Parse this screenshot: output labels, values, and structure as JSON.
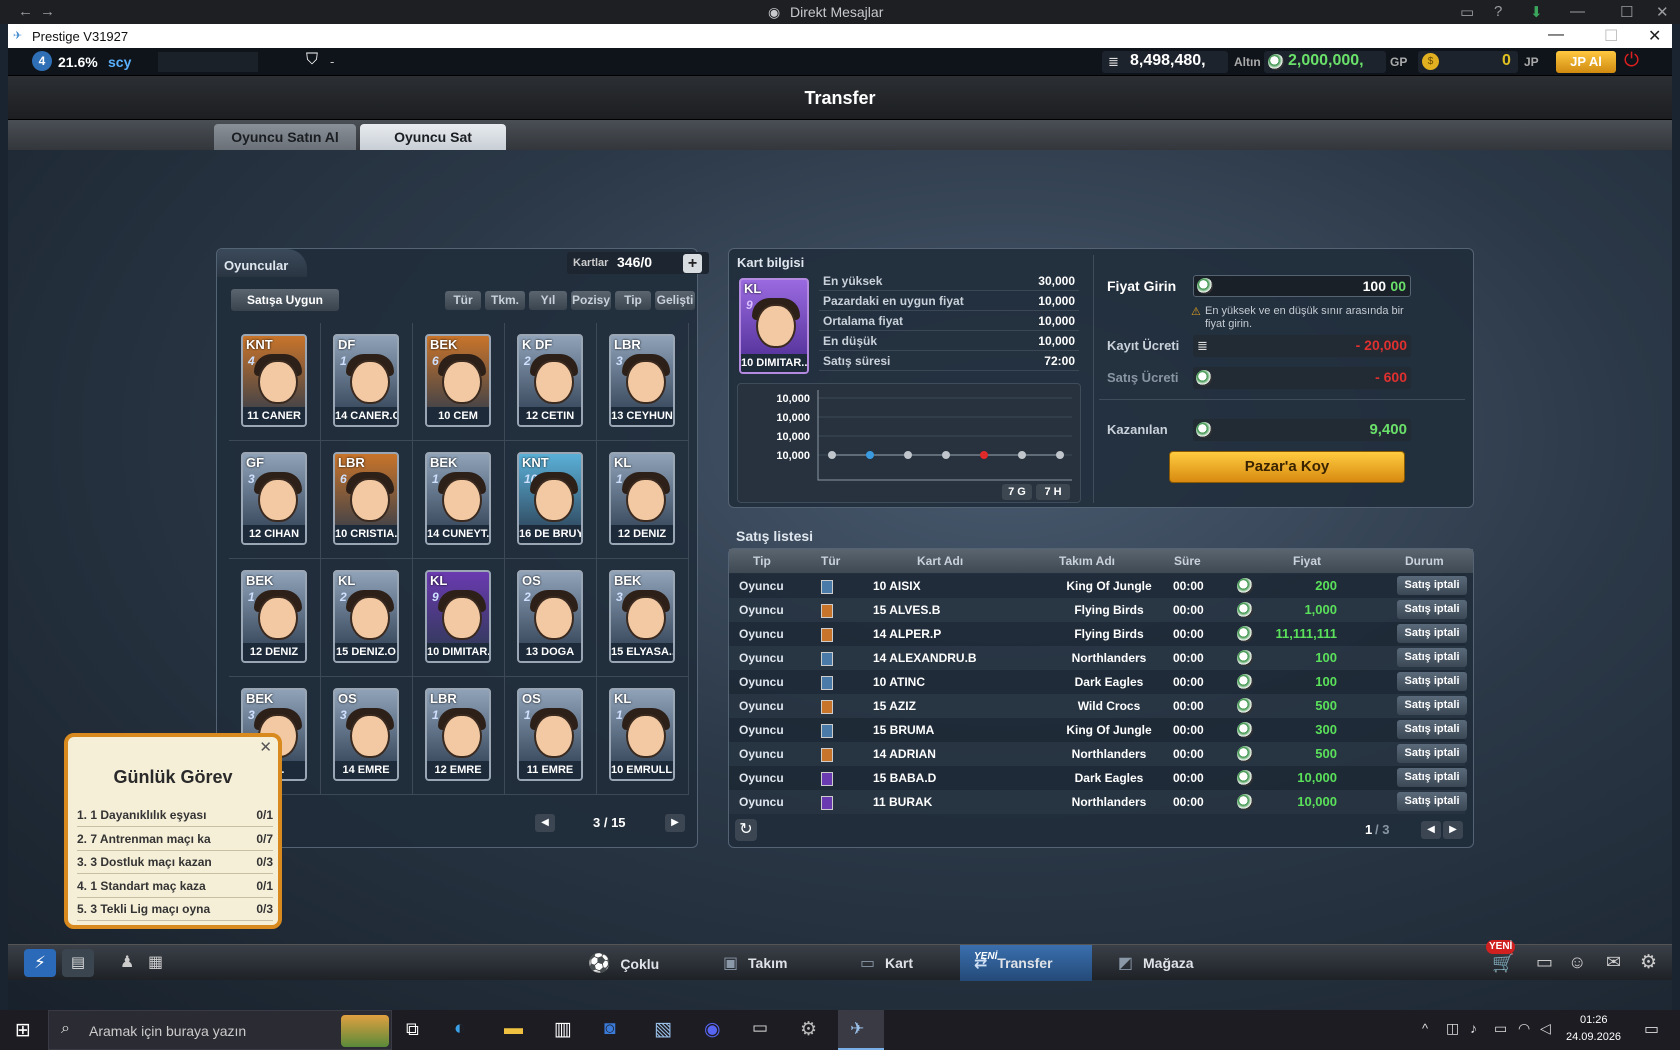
{
  "discord": {
    "title": "Direkt Mesajlar"
  },
  "window": {
    "title": "Prestige V31927"
  },
  "status": {
    "level": "4",
    "percent": "21.6%",
    "user": "scy",
    "guild": "-",
    "gold": "8,498,480,",
    "gold_label": "Altın",
    "gp": "2,000,000,",
    "gp_label": "GP",
    "jp": "0",
    "jp_label": "JP",
    "jp_button": "JP Al"
  },
  "header": {
    "title": "Transfer"
  },
  "tabs": [
    {
      "label": "Oyuncu Satın Al"
    },
    {
      "label": "Oyuncu Sat"
    }
  ],
  "players": {
    "title": "Oyuncular",
    "cards_label": "Kartlar",
    "cards_count": "346/0",
    "dropdown": "Satışa Uygun",
    "filters": [
      "Tür",
      "Tkm.",
      "Yıl",
      "Pozisy",
      "Tip",
      "Gelişti"
    ],
    "cards": [
      {
        "pos": "KNT",
        "lvl": "4",
        "name": "11 CANER",
        "color": "#c8742a"
      },
      {
        "pos": "DF",
        "lvl": "1",
        "name": "14 CANER.O",
        "color": "#8fa2b8"
      },
      {
        "pos": "BEK",
        "lvl": "6",
        "name": "10 CEM",
        "color": "#c8742a"
      },
      {
        "pos": "K DF",
        "lvl": "2",
        "name": "12 CETIN",
        "color": "#8fa2b8"
      },
      {
        "pos": "LBR",
        "lvl": "3",
        "name": "13 CEYHUN",
        "color": "#8fa2b8"
      },
      {
        "pos": "GF",
        "lvl": "3",
        "name": "12 CIHAN",
        "color": "#8fa2b8"
      },
      {
        "pos": "LBR",
        "lvl": "6",
        "name": "10 CRISTIA..",
        "color": "#c8742a"
      },
      {
        "pos": "BEK",
        "lvl": "1",
        "name": "14 CUNEYT..",
        "color": "#8fa2b8"
      },
      {
        "pos": "KNT",
        "lvl": "10",
        "name": "16 DE BRUY..",
        "color": "#5ab0d8"
      },
      {
        "pos": "KL",
        "lvl": "1",
        "name": "12 DENIZ",
        "color": "#8fa2b8"
      },
      {
        "pos": "BEK",
        "lvl": "1",
        "name": "12 DENIZ",
        "color": "#8fa2b8"
      },
      {
        "pos": "KL",
        "lvl": "2",
        "name": "15 DENIZ.O",
        "color": "#8fa2b8"
      },
      {
        "pos": "KL",
        "lvl": "9",
        "name": "10 DIMITAR..",
        "color": "#6a3ab0"
      },
      {
        "pos": "OS",
        "lvl": "2",
        "name": "13 DOGA",
        "color": "#8fa2b8"
      },
      {
        "pos": "BEK",
        "lvl": "3",
        "name": "15 ELYASA...",
        "color": "#8fa2b8"
      },
      {
        "pos": "BEK",
        "lvl": "3",
        "name": "..O..",
        "color": "#8fa2b8"
      },
      {
        "pos": "OS",
        "lvl": "3",
        "name": "14 EMRE",
        "color": "#8fa2b8"
      },
      {
        "pos": "LBR",
        "lvl": "1",
        "name": "12 EMRE",
        "color": "#8fa2b8"
      },
      {
        "pos": "OS",
        "lvl": "1",
        "name": "11 EMRE",
        "color": "#8fa2b8"
      },
      {
        "pos": "KL",
        "lvl": "1",
        "name": "10 EMRULL..",
        "color": "#8fa2b8"
      }
    ],
    "page": "3 / 15"
  },
  "card_info": {
    "title": "Kart bilgisi",
    "card_pos": "KL",
    "card_lvl": "9",
    "card_name": "10 DIMITAR..",
    "rows": [
      {
        "label": "En yüksek",
        "value": "30,000"
      },
      {
        "label": "Pazardaki en uygun fiyat",
        "value": "10,000"
      },
      {
        "label": "Ortalama fiyat",
        "value": "10,000"
      },
      {
        "label": "En düşük",
        "value": "10,000"
      },
      {
        "label": "Satış süresi",
        "value": "72:00"
      }
    ],
    "chart_ticks": [
      "10,000",
      "10,000",
      "10,000",
      "10,000"
    ],
    "chart_btn_7g": "7 G",
    "chart_btn_7h": "7 H",
    "price_label": "Fiyat Girin",
    "price_typed": "100",
    "price_hint": "00",
    "warning": "En yüksek ve en düşük sınır arasında bir fiyat girin.",
    "reg_fee_label": "Kayıt Ücreti",
    "reg_fee": "- 20,000",
    "sale_fee_label": "Satış Ücreti",
    "sale_fee": "- 600",
    "earn_label": "Kazanılan",
    "earn": "9,400",
    "sell_button": "Pazar'a Koy"
  },
  "sale_list": {
    "title": "Satış listesi",
    "headers": [
      "Tip",
      "Tür",
      "Kart Adı",
      "Takım Adı",
      "Süre",
      "Fiyat",
      "Durum"
    ],
    "rows": [
      {
        "tip": "Oyuncu",
        "color": "#4a7aa8",
        "name": "10 AISIX",
        "team": "King Of Jungle",
        "time": "00:00",
        "price": "200",
        "status": "Satış iptali"
      },
      {
        "tip": "Oyuncu",
        "color": "#c8742a",
        "name": "15 ALVES.B",
        "team": "Flying Birds",
        "time": "00:00",
        "price": "1,000",
        "status": "Satış iptali"
      },
      {
        "tip": "Oyuncu",
        "color": "#c8742a",
        "name": "14 ALPER.P",
        "team": "Flying Birds",
        "time": "00:00",
        "price": "11,111,111",
        "status": "Satış iptali"
      },
      {
        "tip": "Oyuncu",
        "color": "#4a7aa8",
        "name": "14 ALEXANDRU.B",
        "team": "Northlanders",
        "time": "00:00",
        "price": "100",
        "status": "Satış iptali"
      },
      {
        "tip": "Oyuncu",
        "color": "#4a7aa8",
        "name": "10 ATINC",
        "team": "Dark Eagles",
        "time": "00:00",
        "price": "100",
        "status": "Satış iptali"
      },
      {
        "tip": "Oyuncu",
        "color": "#c8742a",
        "name": "15 AZIZ",
        "team": "Wild Crocs",
        "time": "00:00",
        "price": "500",
        "status": "Satış iptali"
      },
      {
        "tip": "Oyuncu",
        "color": "#4a7aa8",
        "name": "15 BRUMA",
        "team": "King Of Jungle",
        "time": "00:00",
        "price": "300",
        "status": "Satış iptali"
      },
      {
        "tip": "Oyuncu",
        "color": "#c8742a",
        "name": "14 ADRIAN",
        "team": "Northlanders",
        "time": "00:00",
        "price": "500",
        "status": "Satış iptali"
      },
      {
        "tip": "Oyuncu",
        "color": "#6a3ab0",
        "name": "15 BABA.D",
        "team": "Dark Eagles",
        "time": "00:00",
        "price": "10,000",
        "status": "Satış iptali"
      },
      {
        "tip": "Oyuncu",
        "color": "#6a3ab0",
        "name": "11 BURAK",
        "team": "Northlanders",
        "time": "00:00",
        "price": "10,000",
        "status": "Satış iptali"
      }
    ],
    "page_current": "1",
    "page_total": "/ 3"
  },
  "quest": {
    "title": "Günlük Görev",
    "items": [
      {
        "text": "1. 1 Dayanıklılık eşyası",
        "progress": "0/1"
      },
      {
        "text": "2. 7 Antrenman maçı ka",
        "progress": "0/7"
      },
      {
        "text": "3. 3 Dostluk maçı kazan",
        "progress": "0/3"
      },
      {
        "text": "4. 1 Standart maç kaza",
        "progress": "0/1"
      },
      {
        "text": "5. 3 Tekli Lig maçı oyna",
        "progress": "0/3"
      }
    ]
  },
  "nav": {
    "multi": "Çoklu",
    "team": "Takım",
    "card": "Kart",
    "transfer": "Transfer",
    "shop": "Mağaza",
    "new_badge": "YENİ",
    "new_badge2": "YENİ"
  },
  "taskbar": {
    "search": "Aramak için buraya yazın",
    "time": "01:26",
    "date": "24.09.2026"
  }
}
